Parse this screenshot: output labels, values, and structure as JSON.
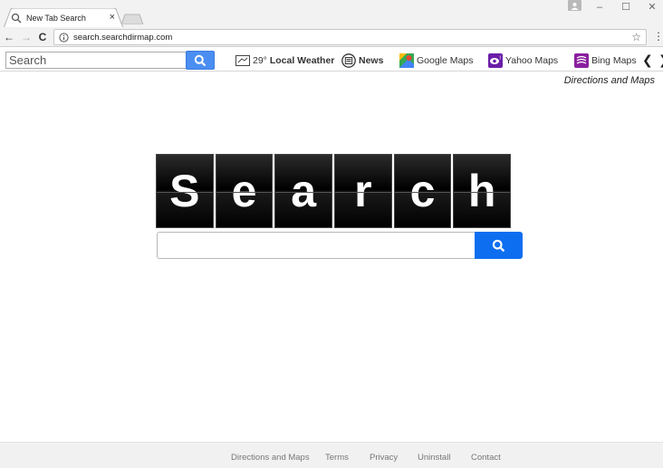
{
  "browser": {
    "tab_title": "New Tab Search",
    "tab_close": "×",
    "url": "search.searchdirmap.com",
    "window_controls": {
      "minimize": "–",
      "maximize": "☐",
      "close": "✕"
    },
    "nav": {
      "back": "←",
      "forward": "→",
      "reload": "C"
    },
    "star": "☆",
    "menu": "⋮"
  },
  "toolbar": {
    "search_placeholder": "Search",
    "weather_temp": "29°",
    "weather_label": "Local Weather",
    "news_label": "News",
    "google_maps_label": "Google Maps",
    "yahoo_maps_label": "Yahoo Maps",
    "bing_maps_label": "Bing Maps",
    "prev": "❮",
    "next": "❯"
  },
  "page": {
    "directions_link": "Directions and Maps",
    "logo_letters": [
      "S",
      "e",
      "a",
      "r",
      "c",
      "h"
    ],
    "search_value": ""
  },
  "footer": {
    "links": [
      "Directions and Maps",
      "Terms",
      "Privacy",
      "Uninstall",
      "Contact"
    ]
  },
  "colors": {
    "toolbar_search_button": "#4b8ef1",
    "main_search_button": "#0d6ef0",
    "yahoo_purple": "#6b1ea8",
    "bing_purple": "#8a1f9e"
  }
}
